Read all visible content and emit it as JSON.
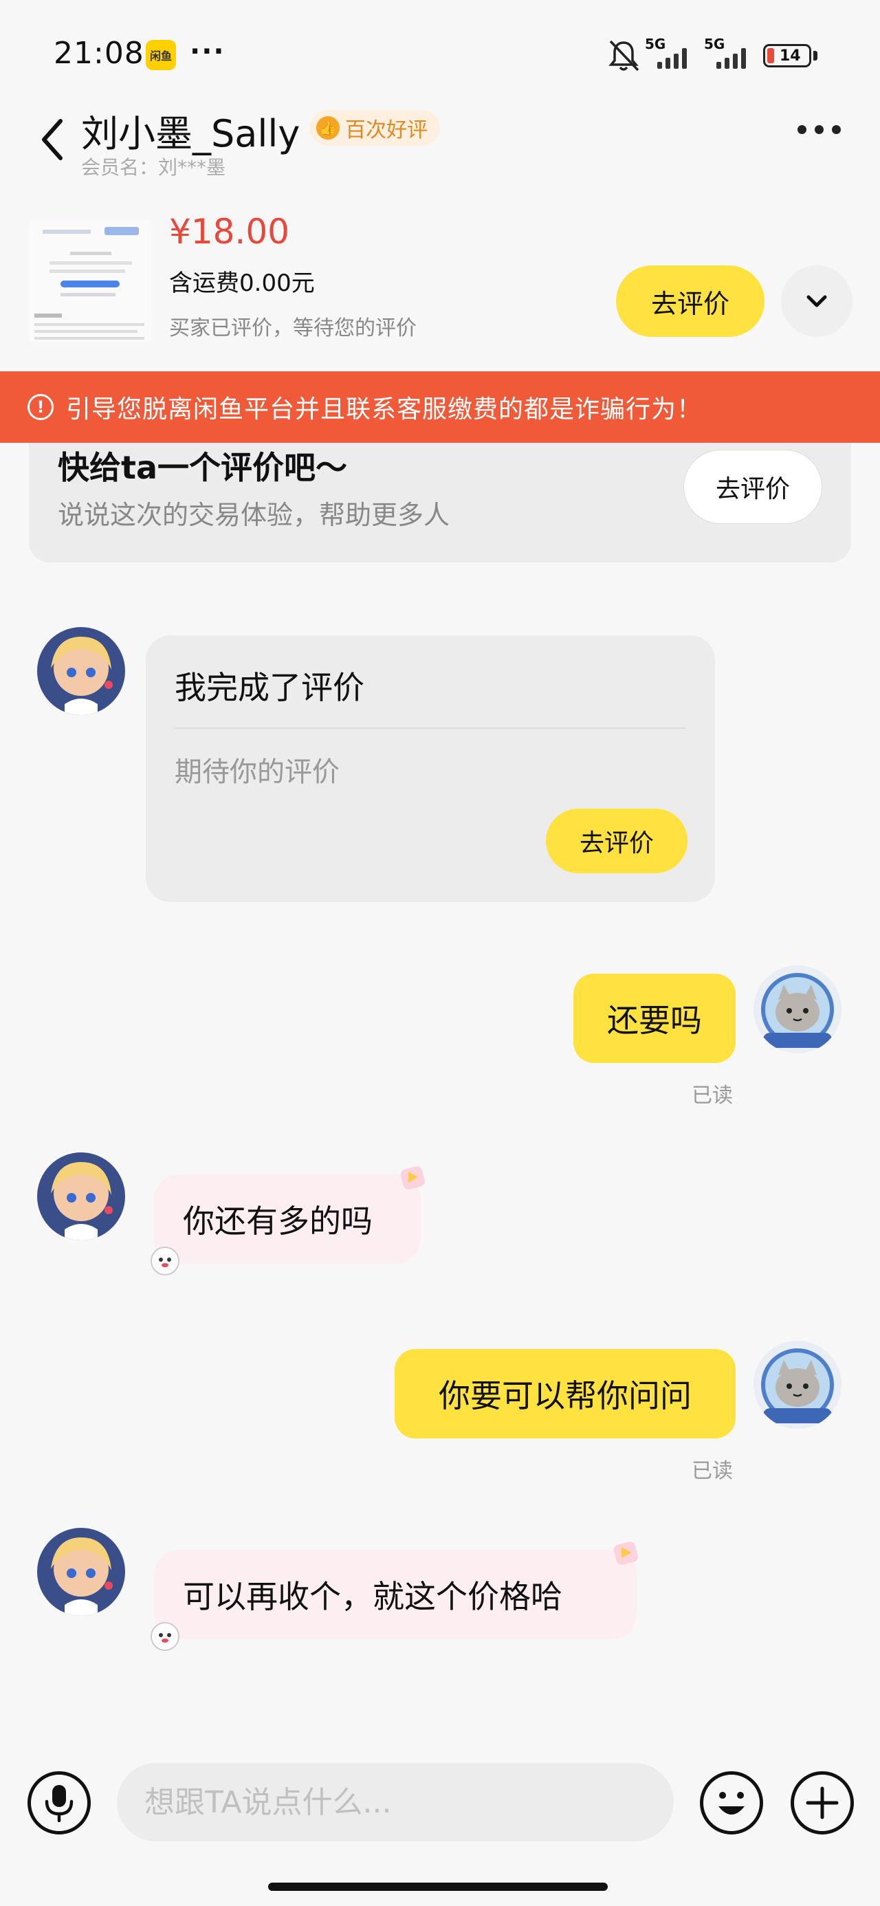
{
  "status_bar": {
    "time": "21:08",
    "app_icon_label": "闲鱼",
    "more": "···",
    "network_1": "5G",
    "network_2": "5G",
    "battery": "14"
  },
  "header": {
    "contact_name": "刘小墨_Sally",
    "badge": "百次好评",
    "member_name": "会员名：刘***墨"
  },
  "product": {
    "price": "¥18.00",
    "shipping": "含运费0.00元",
    "review_status": "买家已评价，等待您的评价",
    "review_button": "去评价"
  },
  "warning": {
    "text": "引导您脱离闲鱼平台并且联系客服缴费的都是诈骗行为！"
  },
  "review_card": {
    "title": "快给ta一个评价吧～",
    "subtitle": "说说这次的交易体验，帮助更多人",
    "button": "去评价"
  },
  "messages": {
    "system_card": {
      "title": "我完成了评价",
      "subtitle": "期待你的评价",
      "button": "去评价"
    },
    "out_1": {
      "text": "还要吗",
      "status": "已读"
    },
    "in_1": {
      "text": "你还有多的吗"
    },
    "out_2": {
      "text": "你要可以帮你问问",
      "status": "已读"
    },
    "in_2": {
      "text": "可以再收个，就这个价格哈"
    }
  },
  "input_bar": {
    "placeholder": "想跟TA说点什么..."
  },
  "colors": {
    "accent_yellow": "#ffe23f",
    "warning_red": "#f05a38",
    "price_red": "#e8473b",
    "incoming_bubble": "#fdeef2"
  }
}
